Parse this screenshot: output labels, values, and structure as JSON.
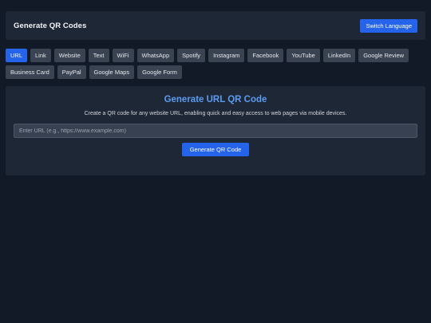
{
  "header": {
    "title": "Generate QR Codes",
    "switch_language": "Switch Language"
  },
  "tabs": [
    {
      "label": "URL",
      "active": true
    },
    {
      "label": "Link"
    },
    {
      "label": "Website"
    },
    {
      "label": "Text"
    },
    {
      "label": "WiFi"
    },
    {
      "label": "WhatsApp"
    },
    {
      "label": "Spotify"
    },
    {
      "label": "Instagram"
    },
    {
      "label": "Facebook"
    },
    {
      "label": "YouTube"
    },
    {
      "label": "LinkedIn"
    },
    {
      "label": "Google Review"
    },
    {
      "label": "Business Card"
    },
    {
      "label": "PayPal"
    },
    {
      "label": "Google Maps"
    },
    {
      "label": "Google Form"
    }
  ],
  "main": {
    "title": "Generate URL QR Code",
    "description": "Create a QR code for any website URL, enabling quick and easy access to web pages via mobile devices.",
    "input_placeholder": "Enter URL (e.g., https://www.example.com)",
    "input_value": "",
    "generate_label": "Generate QR Code"
  },
  "colors": {
    "background": "#131a27",
    "panel": "#1e2735",
    "accent": "#2563eb",
    "title_accent": "#5b9bf0",
    "tab": "#3a4352"
  }
}
